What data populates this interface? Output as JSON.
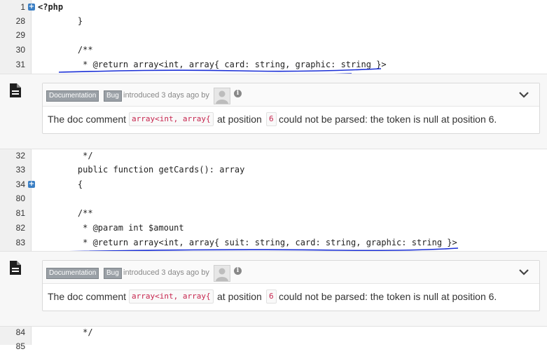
{
  "lines_top": [
    {
      "num": "1",
      "code": "<?php",
      "expandable": true
    },
    {
      "num": "28",
      "code": "    }",
      "expandable": false
    },
    {
      "num": "29",
      "code": "",
      "expandable": false
    },
    {
      "num": "30",
      "code": "    /**",
      "expandable": false
    },
    {
      "num": "31",
      "code": "     * @return array<int, array{ card: string, graphic: string }>",
      "expandable": false
    }
  ],
  "lines_mid": [
    {
      "num": "32",
      "code": "     */",
      "expandable": false
    },
    {
      "num": "33",
      "code": "    public function getCards(): array",
      "expandable": false
    },
    {
      "num": "34",
      "code": "    {",
      "expandable": true
    },
    {
      "num": "80",
      "code": "",
      "expandable": false
    },
    {
      "num": "81",
      "code": "    /**",
      "expandable": false
    },
    {
      "num": "82",
      "code": "     * @param int $amount",
      "expandable": false
    },
    {
      "num": "83",
      "code": "     * @return array<int, array{ suit: string, card: string, graphic: string }>",
      "expandable": false
    }
  ],
  "lines_bottom": [
    {
      "num": "84",
      "code": "     */",
      "expandable": false
    },
    {
      "num": "85",
      "code": "",
      "expandable": false
    }
  ],
  "issues": [
    {
      "tag1": "Documentation",
      "tag2": "Bug",
      "meta": "introduced 3 days ago by",
      "msg_before": "The doc comment",
      "code1": "array<int, array{",
      "msg_middle": "at position",
      "code2": "6",
      "msg_after": "could not be parsed: the token is null at position 6."
    },
    {
      "tag1": "Documentation",
      "tag2": "Bug",
      "meta": "introduced 3 days ago by",
      "msg_before": "The doc comment",
      "code1": "array<int, array{",
      "msg_middle": "at position",
      "code2": "6",
      "msg_after": "could not be parsed: the token is null at position 6."
    }
  ],
  "colors": {
    "accent": "#3b7fc4",
    "underline": "#1a2fd6",
    "code_red": "#c7254e"
  },
  "icons": {
    "expand": "plus-square-icon",
    "issue": "document-icon",
    "collapse": "chevron-down-icon",
    "info": "info-icon"
  }
}
